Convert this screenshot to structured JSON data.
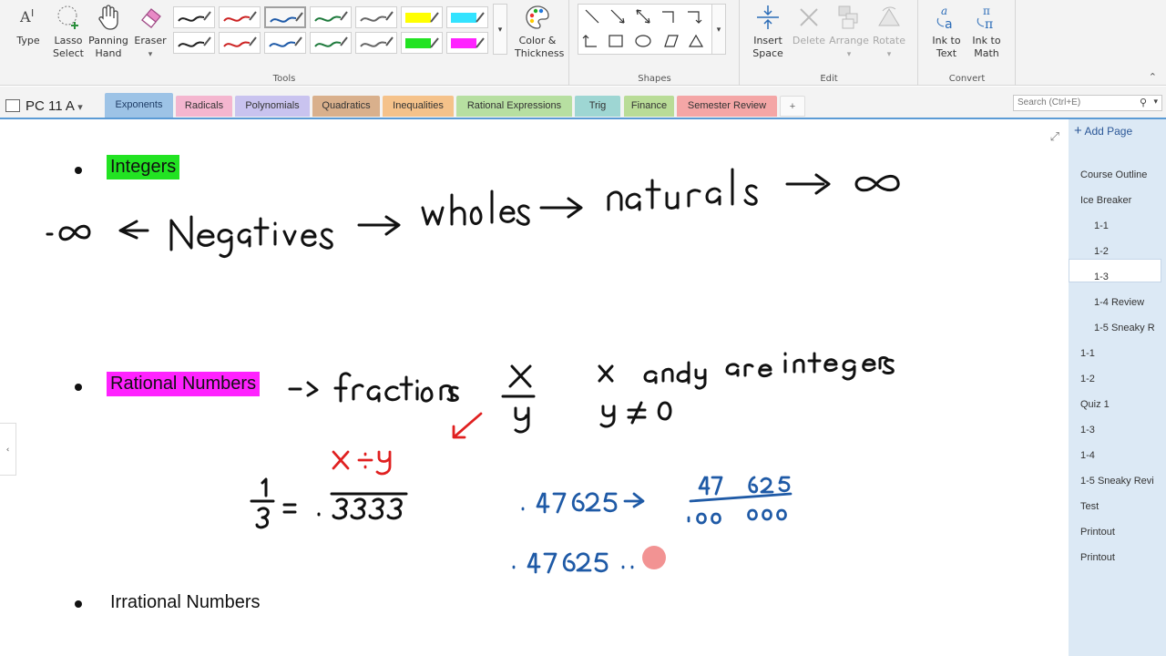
{
  "ribbon": {
    "tools_group": "Tools",
    "shapes_group": "Shapes",
    "edit_group": "Edit",
    "convert_group": "Convert",
    "type": "Type",
    "lasso_line1": "Lasso",
    "lasso_line2": "Select",
    "panning_line1": "Panning",
    "panning_line2": "Hand",
    "eraser": "Eraser",
    "color_line1": "Color &",
    "color_line2": "Thickness",
    "insert_line1": "Insert",
    "insert_line2": "Space",
    "delete": "Delete",
    "arrange": "Arrange",
    "rotate": "Rotate",
    "ink_text_line1": "Ink to",
    "ink_text_line2": "Text",
    "ink_math_line1": "Ink to",
    "ink_math_line2": "Math"
  },
  "pens": {
    "row1": [
      "#222222",
      "#cc2222",
      "#1e5aa8",
      "#1e7a3c",
      "#666666",
      "#ffff00",
      "#33e3ff"
    ],
    "row2": [
      "#222222",
      "#cc2222",
      "#1e5aa8",
      "#1e7a3c",
      "#666666",
      "#22e322",
      "#ff22ff"
    ]
  },
  "notebook": {
    "name": "PC 11 A",
    "chevron": "▾"
  },
  "sections": [
    {
      "label": "Exponents",
      "color": "#9dc3e6"
    },
    {
      "label": "Radicals",
      "color": "#f4b6cf"
    },
    {
      "label": "Polynomials",
      "color": "#c9c3ef"
    },
    {
      "label": "Quadratics",
      "color": "#d9b08c"
    },
    {
      "label": "Inequalities",
      "color": "#f5c28a"
    },
    {
      "label": "Rational Expressions",
      "color": "#b7dfa1"
    },
    {
      "label": "Trig",
      "color": "#9ed6d3"
    },
    {
      "label": "Finance",
      "color": "#b9dc97"
    },
    {
      "label": "Semester Review",
      "color": "#f4a6a6"
    }
  ],
  "add_section": "+",
  "search": {
    "placeholder": "Search (Ctrl+E)"
  },
  "sidebar": {
    "add_page": "Add Page",
    "pages": [
      "Course Outline",
      "Ice Breaker",
      "1-1",
      "1-2",
      "1-3",
      "1-4 Review",
      "1-5 Sneaky R",
      "1-1",
      "1-2",
      "Quiz 1",
      "1-3",
      "1-4",
      "1-5 Sneaky Revi",
      "Test",
      "Printout",
      "Printout"
    ],
    "selected_index": 2
  },
  "content": {
    "bullet1": "Integers",
    "bullet1_highlight": "#22e322",
    "bullet2": "Rational Numbers",
    "bullet2_highlight": "#ff22ff",
    "bullet3": "Irrational Numbers"
  },
  "colors": {
    "accent": "#5b9bd5",
    "ink_black": "#111111",
    "ink_red": "#e02020",
    "ink_blue": "#1f5aa6",
    "pointer": "#f08080"
  }
}
